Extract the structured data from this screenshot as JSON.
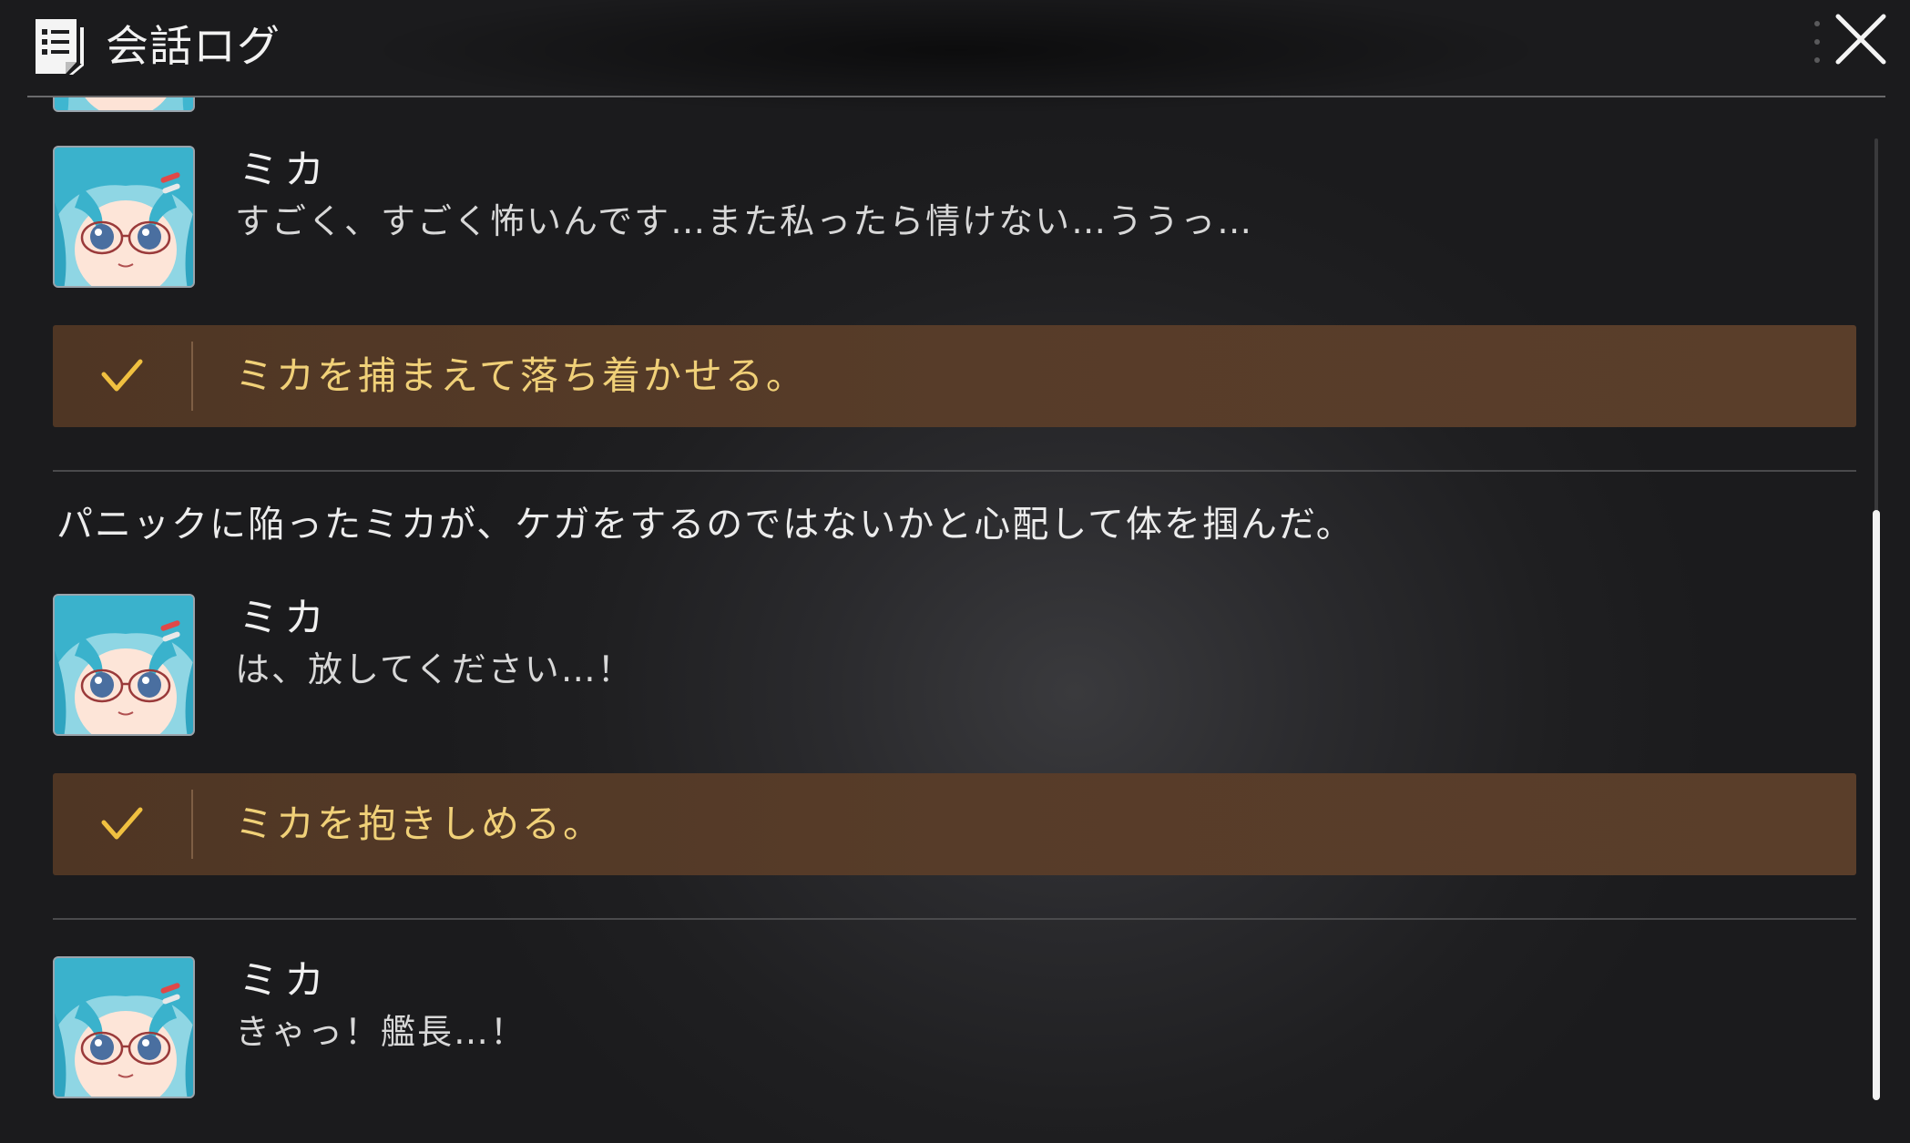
{
  "header": {
    "title": "会話ログ",
    "log_icon": "log-list-icon",
    "close_icon": "close-icon"
  },
  "log": {
    "entries": [
      {
        "speaker": "ミカ",
        "text": "すごく、すごく怖いんです…また私ったら情けない…ううっ…"
      },
      {
        "choice": "ミカを捕まえて落ち着かせる。"
      },
      {
        "narration": "パニックに陥ったミカが、ケガをするのではないかと心配して体を掴んだ。"
      },
      {
        "speaker": "ミカ",
        "text": "は、放してください…！"
      },
      {
        "choice": "ミカを抱きしめる。"
      },
      {
        "speaker": "ミカ",
        "text": "きゃっ！艦長…！"
      }
    ]
  },
  "colors": {
    "choice_bg": "#573c29",
    "choice_text": "#f0d078",
    "check_icon": "#f0c040",
    "scroll_thumb": "#f2f2f2"
  }
}
